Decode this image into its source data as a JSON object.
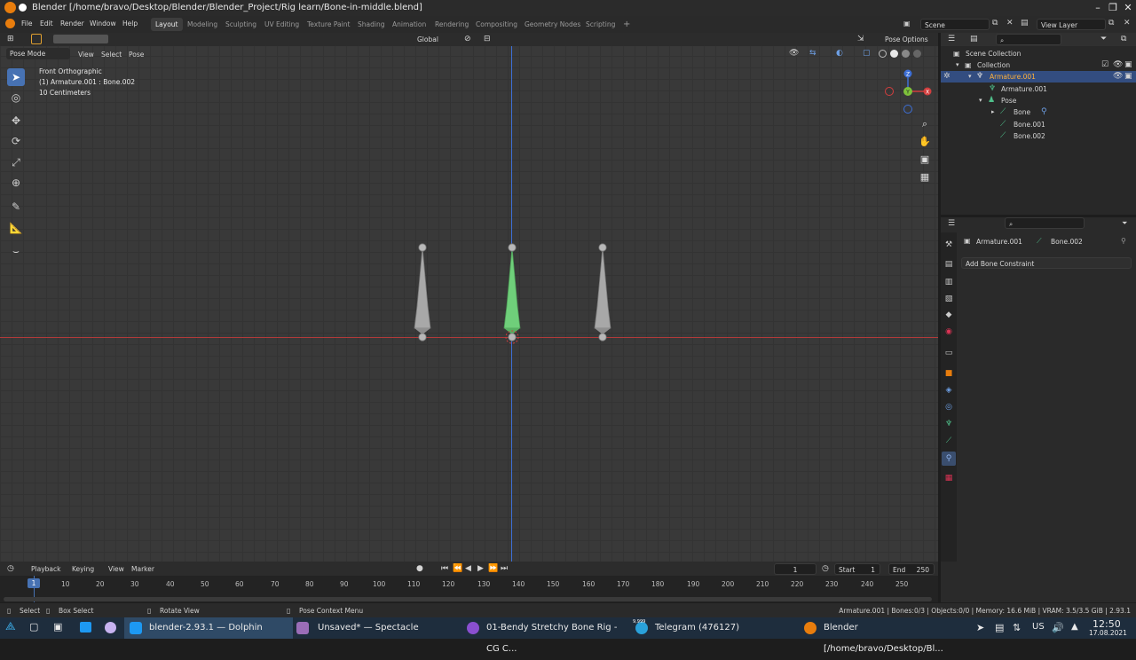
{
  "window": {
    "title": "Blender [/home/bravo/Desktop/Blender/Blender_Project/Rig learn/Bone-in-middle.blend]",
    "min": "–",
    "max": "❐",
    "close": "✕"
  },
  "menu": [
    "File",
    "Edit",
    "Render",
    "Window",
    "Help"
  ],
  "workspaces": [
    "Layout",
    "Modeling",
    "Sculpting",
    "UV Editing",
    "Texture Paint",
    "Shading",
    "Animation",
    "Rendering",
    "Compositing",
    "Geometry Nodes",
    "Scripting"
  ],
  "add_workspace": "+",
  "scene": {
    "label": "Scene"
  },
  "view_layer": {
    "label": "View Layer"
  },
  "viewport": {
    "mode": "Pose Mode",
    "menus": [
      "View",
      "Select",
      "Pose"
    ],
    "orientation": "Global",
    "pose_options": "Pose Options",
    "overlay_lines": [
      "Front Orthographic",
      "(1) Armature.001 : Bone.002",
      "10 Centimeters"
    ],
    "gizmo": {
      "x": "X",
      "y": "Y",
      "z": "Z"
    }
  },
  "tools": [
    "select",
    "cursor",
    "move",
    "rotate",
    "scale",
    "transform",
    "annotate",
    "measure",
    "bone-roll"
  ],
  "outliner": {
    "items": [
      {
        "label": "Scene Collection",
        "depth": 0,
        "selected": false
      },
      {
        "label": "Collection",
        "depth": 1,
        "selected": false
      },
      {
        "label": "Armature.001",
        "depth": 2,
        "selected": true
      },
      {
        "label": "Armature.001",
        "depth": 3,
        "selected": false
      },
      {
        "label": "Pose",
        "depth": 3,
        "selected": false
      },
      {
        "label": "Bone",
        "depth": 4,
        "selected": false
      },
      {
        "label": "Bone.001",
        "depth": 4,
        "selected": false
      },
      {
        "label": "Bone.002",
        "depth": 4,
        "selected": false
      }
    ]
  },
  "properties": {
    "breadcrumb": [
      "Armature.001",
      "Bone.002"
    ],
    "add_constraint": "Add Bone Constraint"
  },
  "timeline": {
    "menus": [
      "Playback",
      "Keying",
      "View",
      "Marker"
    ],
    "current_frame": "1",
    "start_label": "Start",
    "start": "1",
    "end_label": "End",
    "end": "250",
    "ticks": [
      "10",
      "20",
      "30",
      "40",
      "50",
      "60",
      "70",
      "80",
      "90",
      "100",
      "110",
      "120",
      "130",
      "140",
      "150",
      "160",
      "170",
      "180",
      "190",
      "200",
      "210",
      "220",
      "230",
      "240",
      "250"
    ],
    "frame_marker": "1"
  },
  "status": {
    "select": "Select",
    "box_select": "Box Select",
    "rotate_view": "Rotate View",
    "context_menu": "Pose Context Menu",
    "stats": "Armature.001 | Bones:0/3 | Objects:0/0 | Memory: 16.6 MiB | VRAM: 3.5/3.5 GiB | 2.93.1"
  },
  "taskbar": {
    "tasks": [
      {
        "label": "blender-2.93.1 — Dolphin",
        "active": true
      },
      {
        "label": "Unsaved* — Spectacle",
        "active": false
      },
      {
        "label": "01-Bendy Stretchy Bone Rig - CG C...",
        "active": false
      },
      {
        "label": "Telegram (476127)",
        "active": false
      },
      {
        "label": "Blender [/home/bravo/Desktop/Bl...",
        "active": false
      }
    ],
    "telegram_badge": "9,999",
    "kbd": "US",
    "time": "12:50",
    "date": "17.08.2021"
  },
  "colors": {
    "accent": "#4772b3",
    "selected_bone": "#6fcf7a",
    "bone": "#a8a8a8",
    "x_axis": "#d23e3e",
    "z_axis": "#3d6fd6"
  }
}
